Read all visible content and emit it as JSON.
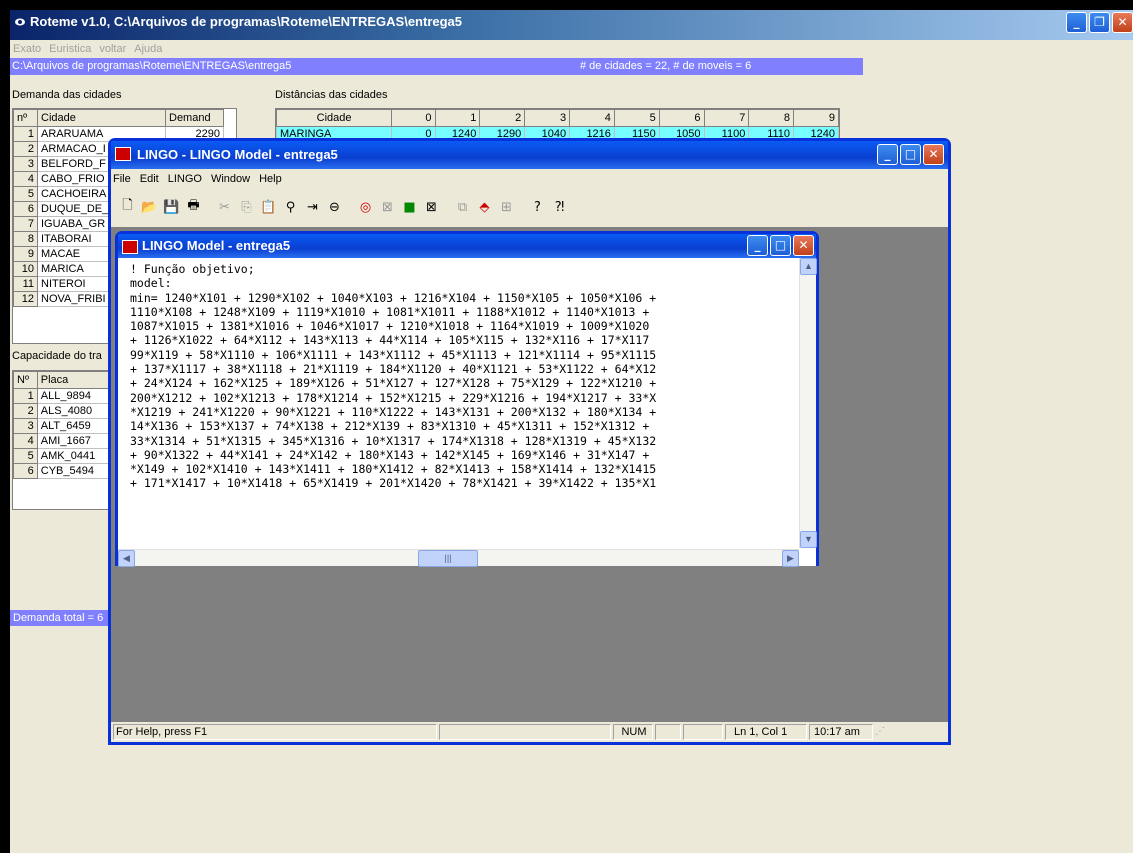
{
  "roteme": {
    "title": "Roteme v1.0,  C:\\Arquivos de programas\\Roteme\\ENTREGAS\\entrega5",
    "menu": [
      "Exato",
      "Euristica",
      "voltar",
      "Ajuda"
    ],
    "path": "C:\\Arquivos de programas\\Roteme\\ENTREGAS\\entrega5",
    "summary": "# de cidades = 22,  # de moveis = 6",
    "demanda_label": "Demanda das cidades",
    "distancias_label": "Distâncias das cidades",
    "capacidade_label": "Capacidade do tra",
    "demanda_total": "Demanda total = 6",
    "demand_headers": [
      "nº",
      "Cidade",
      "Demand"
    ],
    "demand_rows": [
      {
        "n": "1",
        "city": "ARARUAMA",
        "demand": "2290"
      },
      {
        "n": "2",
        "city": "ARMACAO_I",
        "demand": ""
      },
      {
        "n": "3",
        "city": "BELFORD_F",
        "demand": ""
      },
      {
        "n": "4",
        "city": "CABO_FRIO",
        "demand": ""
      },
      {
        "n": "5",
        "city": "CACHOEIRA",
        "demand": ""
      },
      {
        "n": "6",
        "city": "DUQUE_DE_",
        "demand": ""
      },
      {
        "n": "7",
        "city": "IGUABA_GR",
        "demand": ""
      },
      {
        "n": "8",
        "city": "ITABORAI",
        "demand": ""
      },
      {
        "n": "9",
        "city": "MACAE",
        "demand": ""
      },
      {
        "n": "10",
        "city": "MARICA",
        "demand": ""
      },
      {
        "n": "11",
        "city": "NITEROI",
        "demand": ""
      },
      {
        "n": "12",
        "city": "NOVA_FRIBI",
        "demand": ""
      }
    ],
    "dist_headers": [
      "Cidade",
      "0",
      "1",
      "2",
      "3",
      "4",
      "5",
      "6",
      "7",
      "8",
      "9"
    ],
    "dist_row": [
      "MARINGA",
      "0",
      "1240",
      "1290",
      "1040",
      "1216",
      "1150",
      "1050",
      "1100",
      "1110",
      "1240"
    ],
    "cap_headers": [
      "Nº",
      "Placa"
    ],
    "cap_rows": [
      {
        "n": "1",
        "placa": "ALL_9894"
      },
      {
        "n": "2",
        "placa": "ALS_4080"
      },
      {
        "n": "3",
        "placa": "ALT_6459"
      },
      {
        "n": "4",
        "placa": "AMI_1667"
      },
      {
        "n": "5",
        "placa": "AMK_0441"
      },
      {
        "n": "6",
        "placa": "CYB_5494"
      }
    ]
  },
  "lingo": {
    "title": "LINGO - LINGO Model - entrega5",
    "menu": [
      "File",
      "Edit",
      "LINGO",
      "Window",
      "Help"
    ],
    "status": {
      "help": "For Help, press F1",
      "num": "NUM",
      "position": "Ln 1, Col 1",
      "time": "10:17 am"
    },
    "model_window": {
      "title": "LINGO Model - entrega5",
      "code": "! Função objetivo;\nmodel:\nmin= 1240*X101 + 1290*X102 + 1040*X103 + 1216*X104 + 1150*X105 + 1050*X106 +\n1110*X108 + 1248*X109 + 1119*X1010 + 1081*X1011 + 1188*X1012 + 1140*X1013 +\n1087*X1015 + 1381*X1016 + 1046*X1017 + 1210*X1018 + 1164*X1019 + 1009*X1020\n+ 1126*X1022 + 64*X112 + 143*X113 + 44*X114 + 105*X115 + 132*X116 + 17*X117\n99*X119 + 58*X1110 + 106*X1111 + 143*X1112 + 45*X1113 + 121*X1114 + 95*X1115\n+ 137*X1117 + 38*X1118 + 21*X1119 + 184*X1120 + 40*X1121 + 53*X1122 + 64*X12\n+ 24*X124 + 162*X125 + 189*X126 + 51*X127 + 127*X128 + 75*X129 + 122*X1210 +\n200*X1212 + 102*X1213 + 178*X1214 + 152*X1215 + 229*X1216 + 194*X1217 + 33*X\n*X1219 + 241*X1220 + 90*X1221 + 110*X1222 + 143*X131 + 200*X132 + 180*X134 +\n14*X136 + 153*X137 + 74*X138 + 212*X139 + 83*X1310 + 45*X1311 + 152*X1312 +\n33*X1314 + 51*X1315 + 345*X1316 + 10*X1317 + 174*X1318 + 128*X1319 + 45*X132\n+ 90*X1322 + 44*X141 + 24*X142 + 180*X143 + 142*X145 + 169*X146 + 31*X147 +\n*X149 + 102*X1410 + 143*X1411 + 180*X1412 + 82*X1413 + 158*X1414 + 132*X1415\n+ 171*X1417 + 10*X1418 + 65*X1419 + 201*X1420 + 78*X1421 + 39*X1422 + 135*X1"
    }
  },
  "colors": {
    "title_blue": "#0054e3",
    "path_bar": "#8080ff",
    "mdi_background": "#808080"
  }
}
